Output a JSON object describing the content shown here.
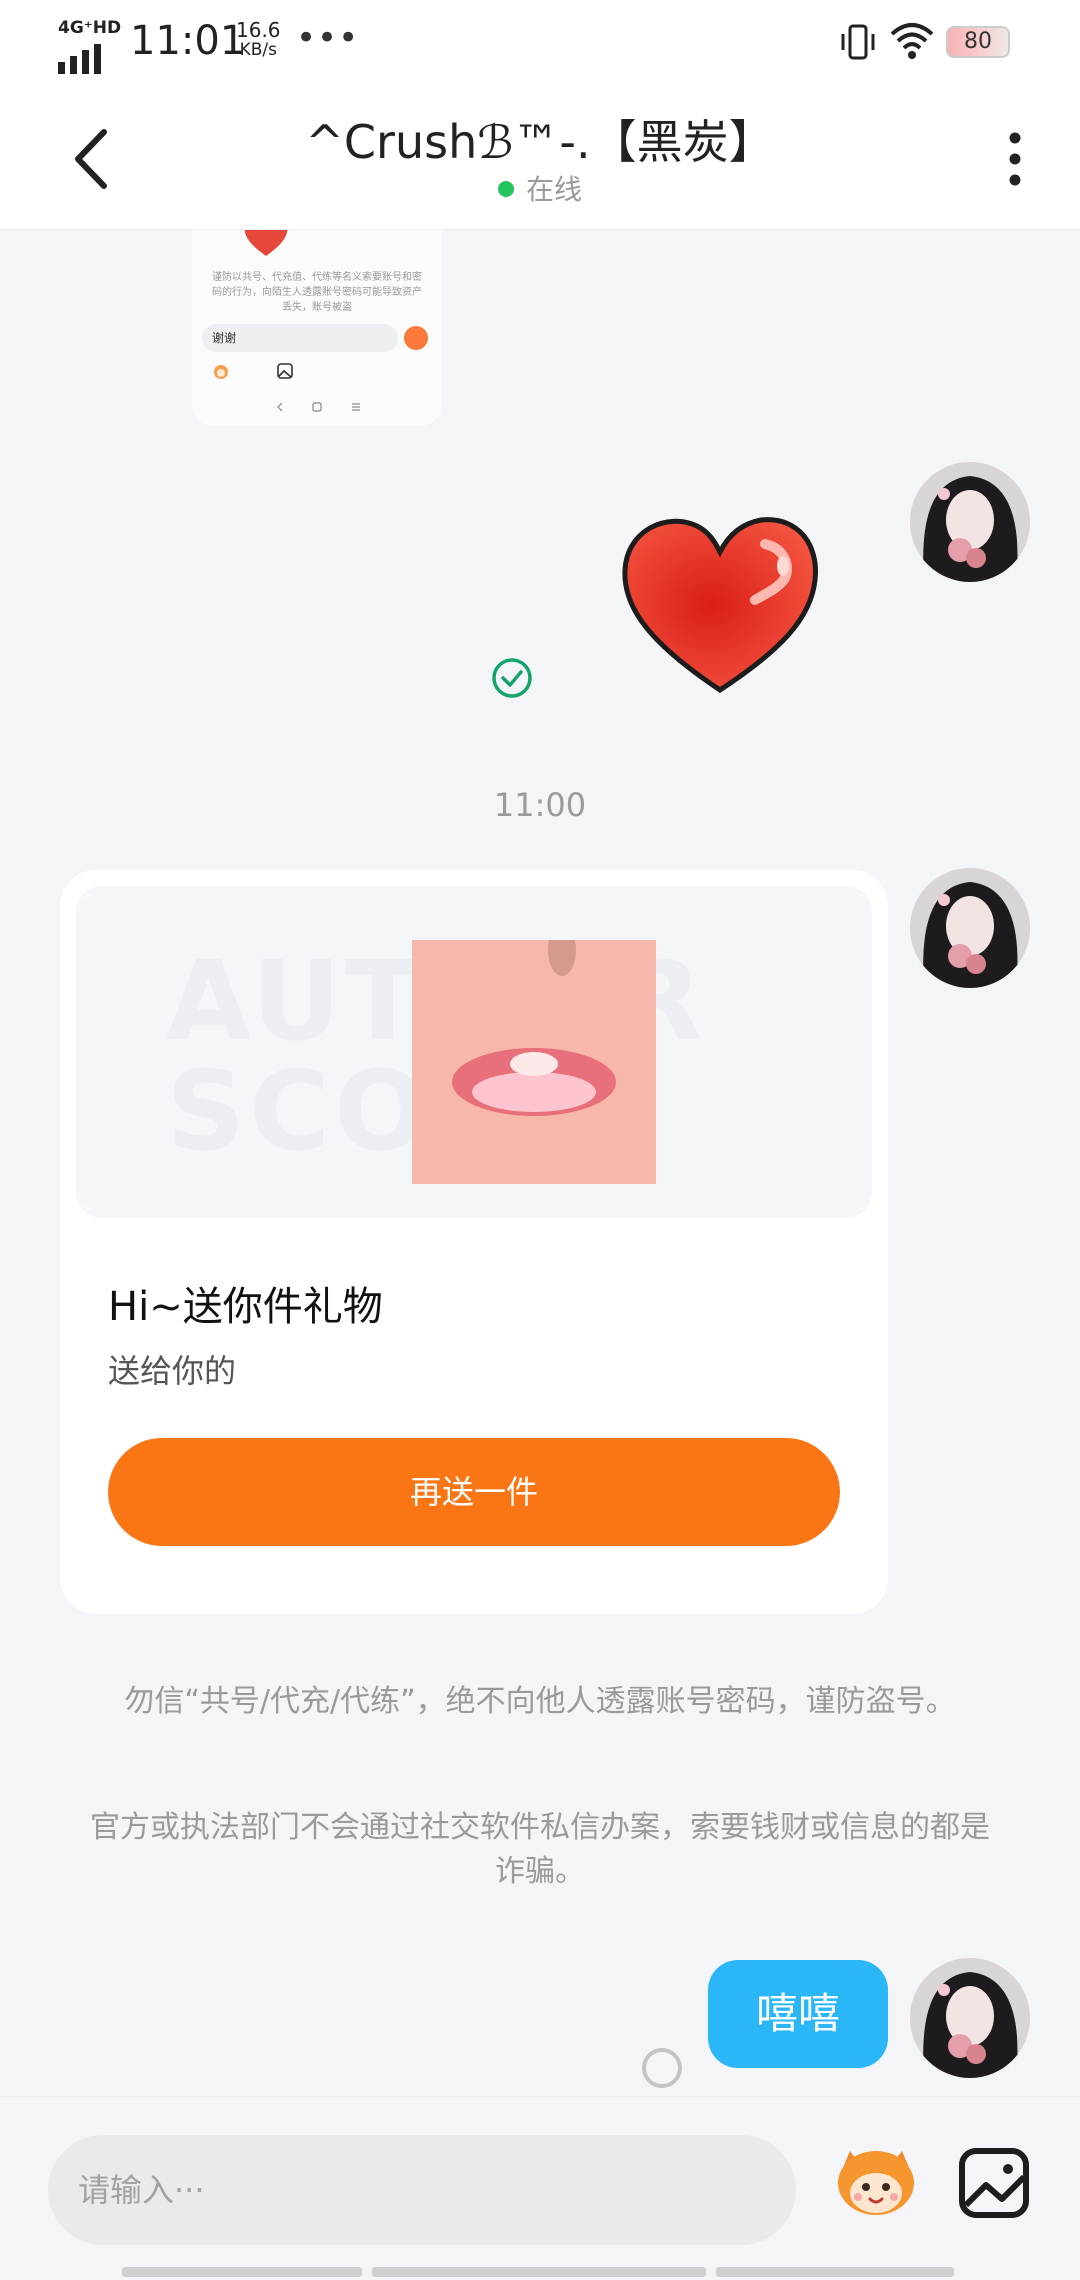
{
  "status_bar": {
    "network": "4G⁺HD",
    "time": "11:01",
    "speed_value": "16.6",
    "speed_unit": "KB/s",
    "dots": "•••",
    "battery": "80"
  },
  "header": {
    "title": "^Crushℬ™-.【黑炭】",
    "status": "在线"
  },
  "thumbnail": {
    "warning": "谨防以共号、代充值、代练等名义索要账号和密码的行为，向陌生人透露账号密码可能导致资产丢失，账号被盗",
    "input_text": "谢谢"
  },
  "timestamp": "11:00",
  "gift_card": {
    "watermark": "AUTHOR SCORE",
    "title": "Hi~送你件礼物",
    "subtitle": "送给你的",
    "button": "再送一件"
  },
  "notices": [
    "勿信“共号/代充/代练”，绝不向他人透露账号密码，谨防盗号。",
    "官方或执法部门不会通过社交软件私信办案，索要钱财或信息的都是诈骗。"
  ],
  "last_message": "嘻嘻",
  "input": {
    "placeholder": "请输入···"
  },
  "colors": {
    "accent_orange": "#fa7514",
    "bubble_blue": "#2bb6f7",
    "online_green": "#22c55e"
  }
}
